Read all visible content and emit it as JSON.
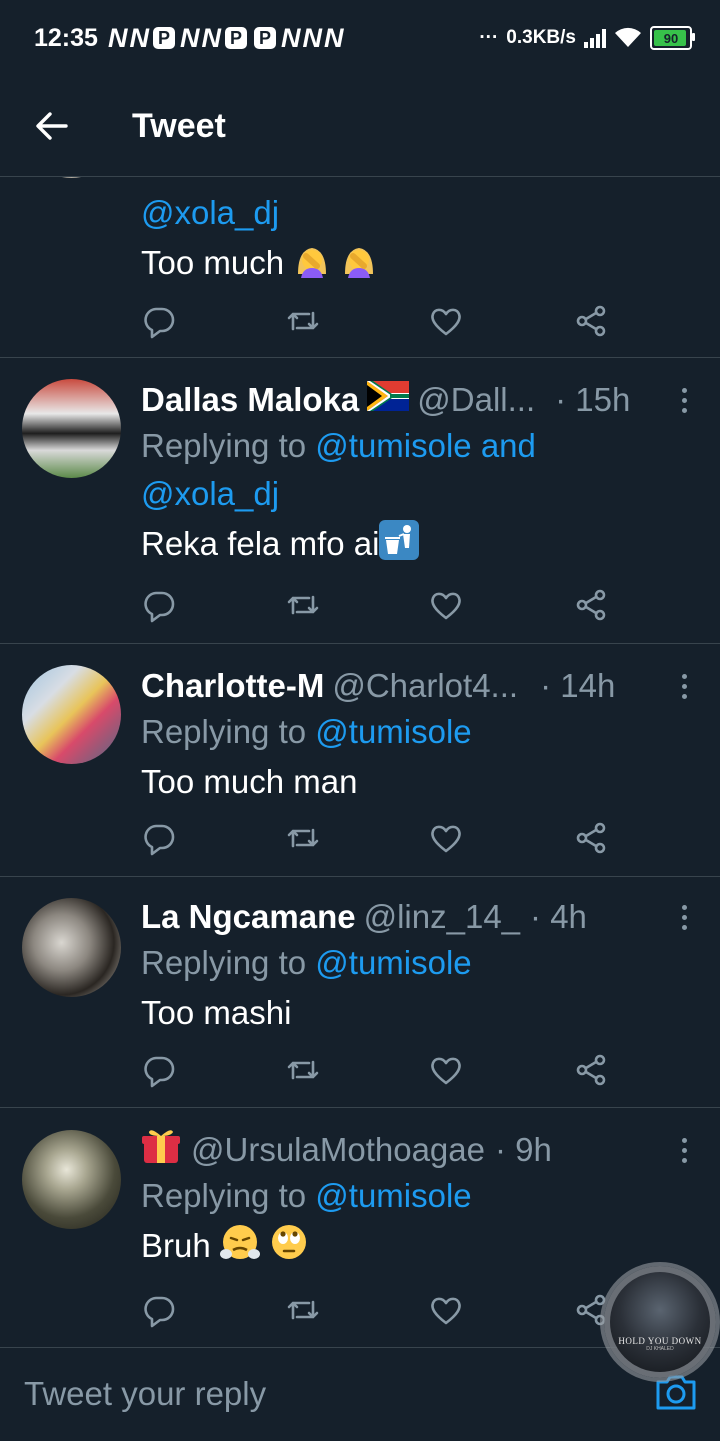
{
  "status_bar": {
    "time": "12:35",
    "net_speed": "0.3KB/s",
    "battery": "90",
    "notifications": [
      "N",
      "N",
      "P",
      "N",
      "N",
      "P",
      "P",
      "N",
      "N",
      "N"
    ],
    "more": "···"
  },
  "header": {
    "title": "Tweet",
    "back_icon": "arrow-left-icon"
  },
  "tweets": [
    {
      "mention_cont": "@xola_dj",
      "text": "Too much",
      "emojis": [
        "woman-facepalming",
        "woman-facepalming"
      ]
    },
    {
      "name": "Dallas Maloka",
      "flag": "south-africa-flag",
      "handle": "@Dall...",
      "time": "· 15h",
      "replying_prefix": "Replying to",
      "mentions": "@tumisole and",
      "mentions_line2": "@xola_dj",
      "text": "Reka fela mfo ai",
      "emojis": [
        "litter-in-bin-sign"
      ]
    },
    {
      "name": "Charlotte-M",
      "handle": "@Charlot4...",
      "time": "· 14h",
      "replying_prefix": "Replying to",
      "mentions": "@tumisole",
      "text": "Too much man"
    },
    {
      "name": "La Ngcamane",
      "handle": "@linz_14_",
      "time": "· 4h",
      "replying_prefix": "Replying to",
      "mentions": "@tumisole",
      "text": "Too mashi"
    },
    {
      "name_emoji": "gift",
      "handle": "@UrsulaMothoagae",
      "time": "· 9h",
      "replying_prefix": "Replying to",
      "mentions": "@tumisole",
      "text": "Bruh",
      "emojis": [
        "face-with-steam",
        "face-with-rolling-eyes"
      ]
    }
  ],
  "action_icons": [
    "reply-icon",
    "retweet-icon",
    "like-icon",
    "share-icon"
  ],
  "reply_bar": {
    "placeholder": "Tweet your reply",
    "camera_icon": "camera-icon"
  },
  "music_bubble": {
    "title": "HOLD YOU DOWN",
    "artist": "DJ KHALED"
  },
  "colors": {
    "background": "#15202b",
    "divider": "#38444d",
    "secondary_text": "#8899a6",
    "accent": "#1d9bf0"
  }
}
